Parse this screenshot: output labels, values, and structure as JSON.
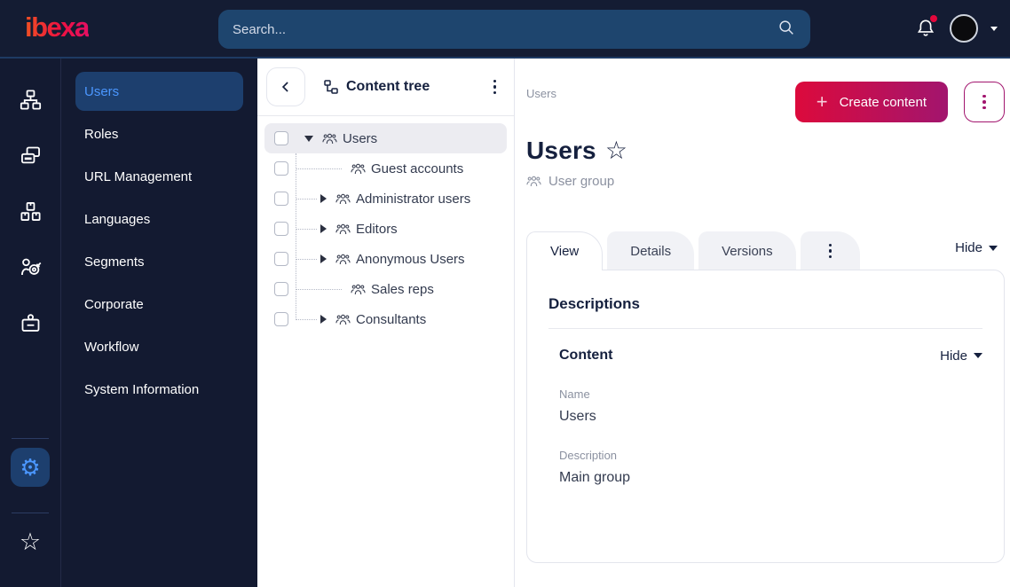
{
  "topbar": {
    "logo_text": "ibexa",
    "search": {
      "placeholder": "Search...",
      "icon": "magnifier-icon"
    },
    "notifications": {
      "icon": "bell-icon",
      "unread_dot": true,
      "dot_color": "#e3073c"
    },
    "user": {
      "avatar": "avatar-circle",
      "caret": "chevron-down"
    }
  },
  "icons": {
    "gear": "⚙",
    "star": "☆"
  },
  "rail": {
    "items": [
      {
        "icon": "sitemap-icon"
      },
      {
        "icon": "content-cards-icon"
      },
      {
        "icon": "product-boxes-icon"
      },
      {
        "icon": "personalization-target-icon"
      },
      {
        "icon": "id-badge-icon"
      }
    ],
    "bottom": [
      {
        "icon": "gear-icon",
        "active": true
      },
      {
        "icon": "star-icon",
        "active": false
      }
    ]
  },
  "menu": {
    "items": [
      {
        "label": "Users",
        "active": true
      },
      {
        "label": "Roles",
        "active": false
      },
      {
        "label": "URL Management",
        "active": false
      },
      {
        "label": "Languages",
        "active": false
      },
      {
        "label": "Segments",
        "active": false
      },
      {
        "label": "Corporate",
        "active": false
      },
      {
        "label": "Workflow",
        "active": false
      },
      {
        "label": "System Information",
        "active": false
      }
    ]
  },
  "content_tree": {
    "title": "Content tree",
    "items": [
      {
        "label": "Users",
        "state": "expanded",
        "selected": true
      },
      {
        "label": "Guest accounts",
        "state": "leaf",
        "selected": false
      },
      {
        "label": "Administrator users",
        "state": "collapsed",
        "selected": false
      },
      {
        "label": "Editors",
        "state": "collapsed",
        "selected": false
      },
      {
        "label": "Anonymous Users",
        "state": "collapsed",
        "selected": false
      },
      {
        "label": "Sales reps",
        "state": "leaf",
        "selected": false
      },
      {
        "label": "Consultants",
        "state": "collapsed",
        "selected": false
      }
    ]
  },
  "main": {
    "breadcrumb": "Users",
    "create_button_label": "Create content",
    "page_title": "Users",
    "content_type_label": "User group",
    "tabs": [
      {
        "label": "View",
        "active": true
      },
      {
        "label": "Details",
        "active": false
      },
      {
        "label": "Versions",
        "active": false
      }
    ],
    "hide_toggle_label": "Hide",
    "card": {
      "section_title": "Descriptions",
      "group_title": "Content",
      "group_hide_label": "Hide",
      "fields": [
        {
          "label": "Name",
          "value": "Users"
        },
        {
          "label": "Description",
          "value": "Main group"
        }
      ]
    }
  },
  "colors": {
    "topbar_bg": "#141c33",
    "search_bg": "#1e456e",
    "accent_blue": "#4b97ff",
    "selected_bg": "#1d3f6e",
    "brand_gradient_start": "#dc0a3c",
    "brand_gradient_end": "#a2156e",
    "notification_dot": "#e3073c"
  }
}
